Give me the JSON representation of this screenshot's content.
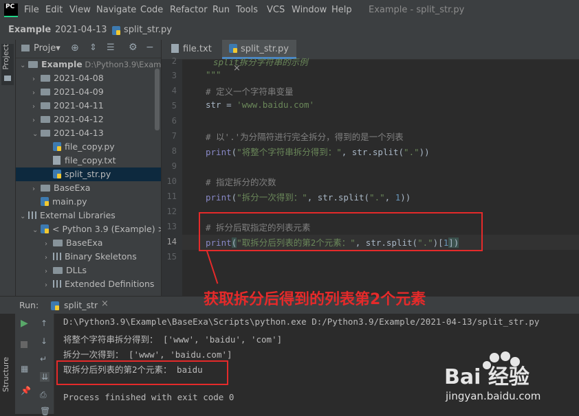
{
  "menubar": {
    "logo": "PC",
    "items": [
      "File",
      "Edit",
      "View",
      "Navigate",
      "Code",
      "Refactor",
      "Run",
      "Tools",
      "VCS",
      "Window",
      "Help"
    ],
    "window_title": "Example - split_str.py"
  },
  "breadcrumb": [
    "Example",
    "2021-04-13",
    "split_str.py"
  ],
  "left_tool": {
    "project_tab": "Project",
    "structure_tab": "Structure"
  },
  "project_panel": {
    "header": "Proje▾",
    "tree": [
      {
        "label": "Example",
        "extra": "D:\\Python3.9\\Exam",
        "kind": "folder",
        "depth": 0,
        "open": true
      },
      {
        "label": "2021-04-08",
        "kind": "folder",
        "depth": 1,
        "open": false
      },
      {
        "label": "2021-04-09",
        "kind": "folder",
        "depth": 1,
        "open": false
      },
      {
        "label": "2021-04-11",
        "kind": "folder",
        "depth": 1,
        "open": false
      },
      {
        "label": "2021-04-12",
        "kind": "folder",
        "depth": 1,
        "open": false
      },
      {
        "label": "2021-04-13",
        "kind": "folder",
        "depth": 1,
        "open": true
      },
      {
        "label": "file_copy.py",
        "kind": "py",
        "depth": 2
      },
      {
        "label": "file_copy.txt",
        "kind": "txt",
        "depth": 2
      },
      {
        "label": "split_str.py",
        "kind": "py",
        "depth": 2,
        "selected": true
      },
      {
        "label": "BaseExa",
        "kind": "folder",
        "depth": 1,
        "open": false
      },
      {
        "label": "main.py",
        "kind": "py",
        "depth": 1
      },
      {
        "label": "External Libraries",
        "kind": "lib",
        "depth": 0,
        "open": true
      },
      {
        "label": "< Python 3.9 (Example) >",
        "kind": "pylib",
        "depth": 1,
        "open": true
      },
      {
        "label": "BaseExa",
        "kind": "folder",
        "depth": 2,
        "open": false
      },
      {
        "label": "Binary Skeletons",
        "kind": "lib",
        "depth": 2,
        "open": false
      },
      {
        "label": "DLLs",
        "kind": "folder",
        "depth": 2,
        "open": false
      },
      {
        "label": "Extended Definitions",
        "kind": "lib",
        "depth": 2,
        "open": false
      }
    ]
  },
  "editor": {
    "tabs": [
      "file.txt",
      "split_str.py"
    ],
    "line_numbers": [
      "2",
      "3",
      "4",
      "5",
      "6",
      "7",
      "8",
      "9",
      "10",
      "11",
      "12",
      "13",
      "14",
      "15"
    ],
    "lines": {
      "l2": "split拆分字符串的示例",
      "l3": "\"\"\"",
      "l4": "# 定义一个字符串变量",
      "l5_a": "str = ",
      "l5_b": "'www.baidu.com'",
      "l7": "# 以'.'为分隔符进行完全拆分，得到的是一个列表",
      "l8_a": "print",
      "l8_b": "(",
      "l8_c": "\"将整个字符串拆分得到：\"",
      "l8_d": ", str.split(",
      "l8_e": "\".\"",
      "l8_f": "))",
      "l10": "# 指定拆分的次数",
      "l11_a": "print",
      "l11_b": "(",
      "l11_c": "\"拆分一次得到：\"",
      "l11_d": ", str.split(",
      "l11_e": "\".\"",
      "l11_f": ", ",
      "l11_g": "1",
      "l11_h": "))",
      "l13": "# 拆分后取指定的列表元素",
      "l14_a": "print",
      "l14_b": "(",
      "l14_c": "\"取拆分后列表的第2个元素：\"",
      "l14_d": ", str.split(",
      "l14_e": "\".\"",
      "l14_f": ")[",
      "l14_g": "1",
      "l14_h": "])"
    }
  },
  "annotation": {
    "callout": "获取拆分后得到的列表第2个元素"
  },
  "run": {
    "label": "Run:",
    "config": "split_str",
    "output": [
      "D:\\Python3.9\\Example\\BaseExa\\Scripts\\python.exe D:/Python3.9/Example/2021-04-13/split_str.py",
      "将整个字符串拆分得到： ['www', 'baidu', 'com']",
      "拆分一次得到： ['www', 'baidu.com']",
      "取拆分后列表的第2个元素： baidu",
      "",
      "Process finished with exit code 0"
    ]
  },
  "watermark": {
    "logo": "Bai  经验",
    "site": "jingyan.baidu.com"
  },
  "colors": {
    "background": "#2b2b2b",
    "panel": "#3c3f41",
    "highlight_red": "#e52a2a",
    "accent_blue": "#4a88c7"
  }
}
